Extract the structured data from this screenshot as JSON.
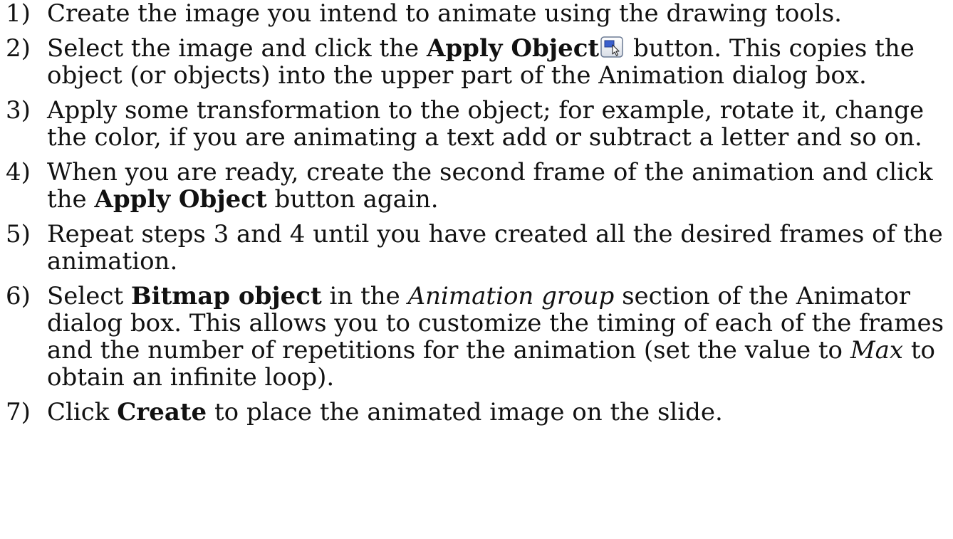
{
  "steps": [
    {
      "number": "1)",
      "parts": [
        "Create the image you intend to animate using the drawing tools."
      ]
    },
    {
      "number": "2)",
      "parts": [
        "Select the image and click the ",
        "Apply Object",
        " button. This copies the object (or objects) into the upper part of the Animation dialog box."
      ],
      "icon": "apply-object-icon"
    },
    {
      "number": "3)",
      "parts": [
        "Apply some transformation to the object; for example, rotate it, change the color, if you are animating a text add or subtract a letter and so on."
      ]
    },
    {
      "number": "4)",
      "parts": [
        "When you are ready, create the second frame of the animation and click the ",
        "Apply Object",
        " button again."
      ]
    },
    {
      "number": "5)",
      "parts": [
        "Repeat steps 3 and 4 until you have created all the desired frames of the animation."
      ]
    },
    {
      "number": "6)",
      "parts": [
        "Select ",
        "Bitmap object",
        " in the ",
        "Animation group",
        " section of the Animator dialog box. This allows you to customize the timing of each of the frames and the number of repetitions for the animation (set the value to ",
        "Max",
        " to obtain an  infinite loop)."
      ]
    },
    {
      "number": "7)",
      "parts": [
        "Click ",
        "Create",
        " to place the animated image on the slide."
      ]
    }
  ]
}
